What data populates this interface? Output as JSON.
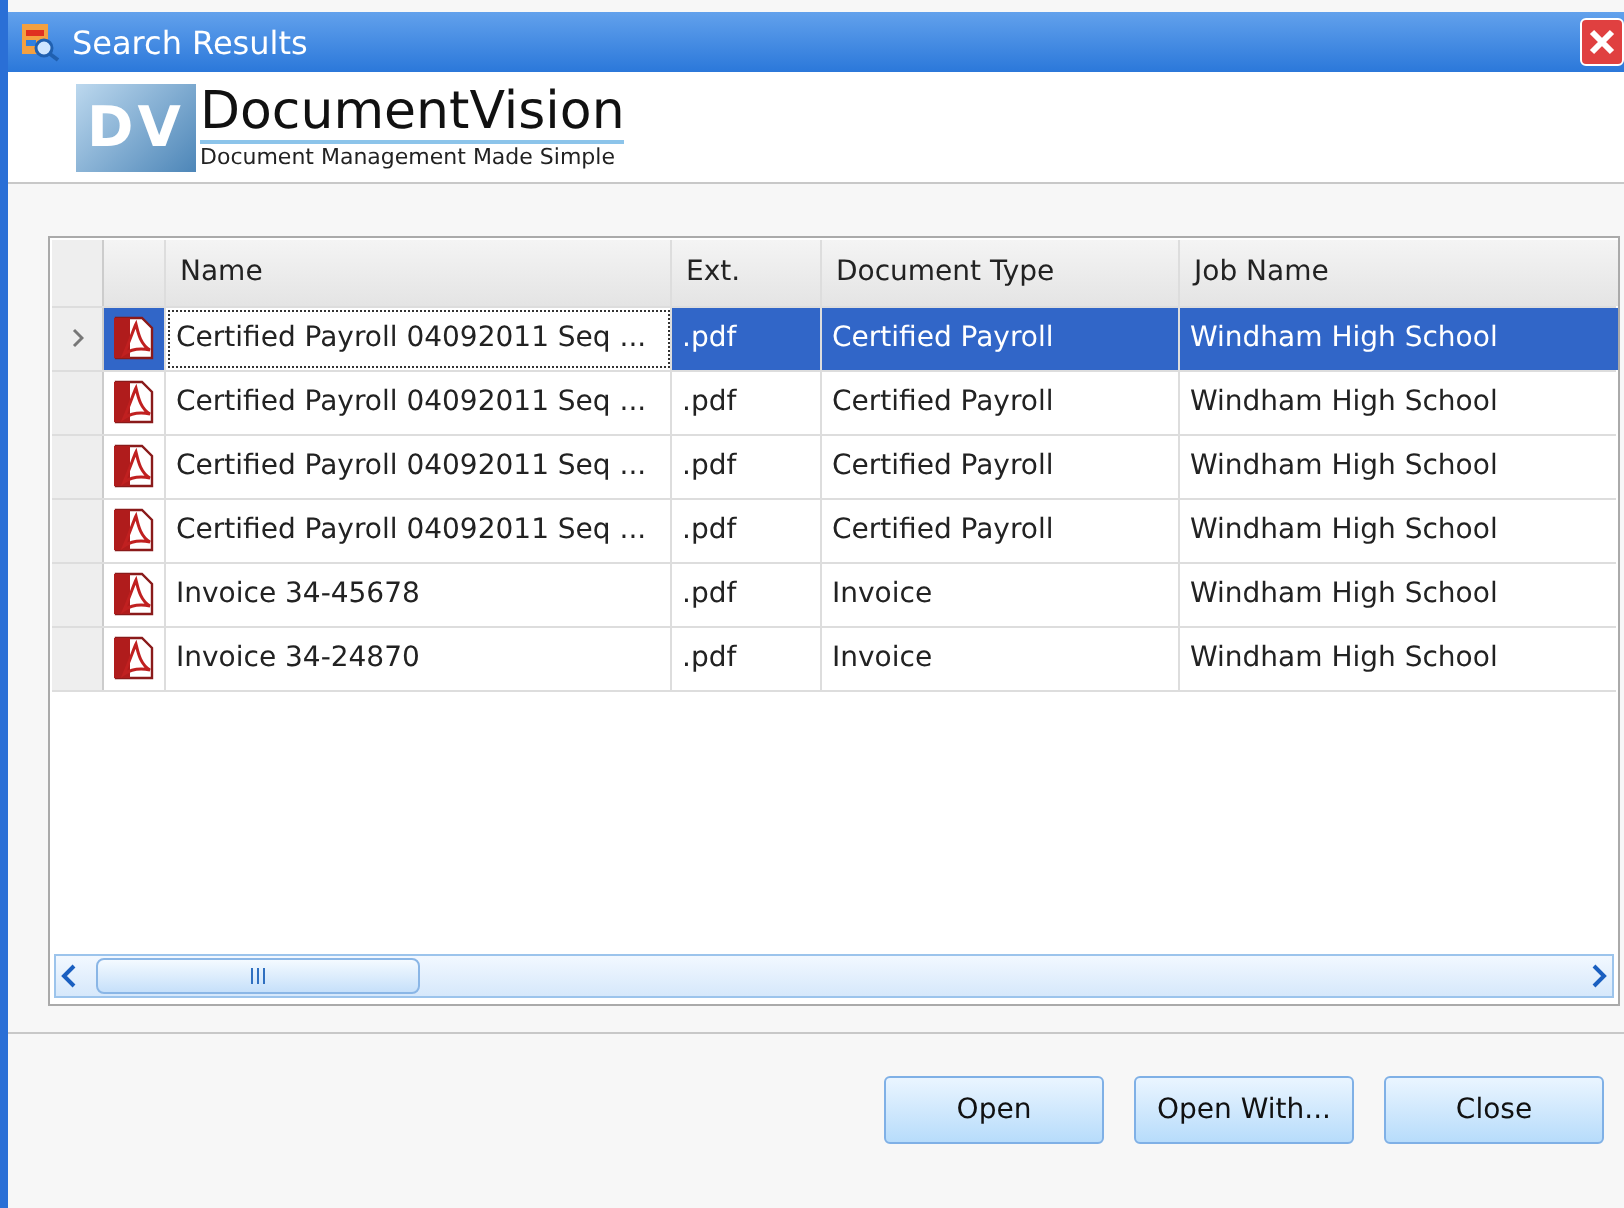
{
  "window": {
    "title": "Search Results"
  },
  "logo": {
    "mark": "DV",
    "name": "DocumentVision",
    "tagline": "Document Management Made Simple"
  },
  "table": {
    "columns": [
      "Name",
      "Ext.",
      "Document Type",
      "Job Name"
    ],
    "rows": [
      {
        "selected": true,
        "cells": [
          "Certified Payroll 04092011 Seq ...",
          ".pdf",
          "Certified Payroll",
          "Windham High School"
        ]
      },
      {
        "selected": false,
        "cells": [
          "Certified Payroll 04092011 Seq ...",
          ".pdf",
          "Certified Payroll",
          "Windham High School"
        ]
      },
      {
        "selected": false,
        "cells": [
          "Certified Payroll 04092011 Seq ...",
          ".pdf",
          "Certified Payroll",
          "Windham High School"
        ]
      },
      {
        "selected": false,
        "cells": [
          "Certified Payroll 04092011 Seq ...",
          ".pdf",
          "Certified Payroll",
          "Windham High School"
        ]
      },
      {
        "selected": false,
        "cells": [
          "Invoice 34-45678",
          ".pdf",
          "Invoice",
          "Windham High School"
        ]
      },
      {
        "selected": false,
        "cells": [
          "Invoice 34-24870",
          ".pdf",
          "Invoice",
          "Windham High School"
        ]
      }
    ]
  },
  "buttons": [
    "Open",
    "Open With...",
    "Close"
  ]
}
